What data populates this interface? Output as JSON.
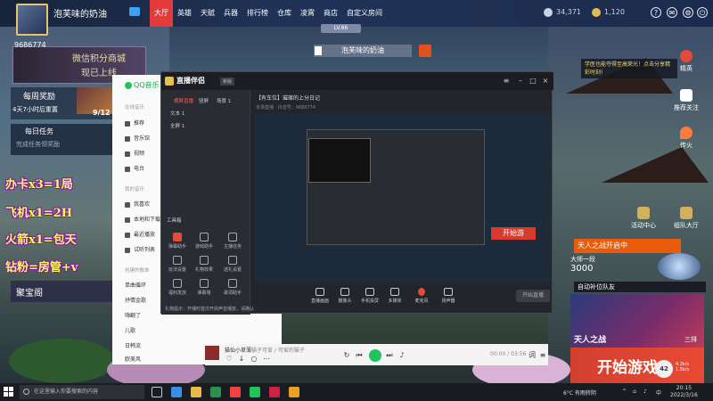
{
  "game": {
    "player_name": "泡芙味的奶油",
    "uid": "9686774",
    "level": "LV.86",
    "nav": [
      "大厅",
      "英雄",
      "天赋",
      "兵器",
      "排行榜",
      "仓库",
      "凌霄",
      "商店",
      "自定义房间"
    ],
    "currency1": "34,371",
    "currency2": "1,120",
    "shop_line1": "微信积分商城",
    "shop_line2": "现已上线",
    "reward_title": "每周奖励",
    "reward_sub": "4天7小时后重置",
    "reward_count": "9/12",
    "daily_title": "每日任务",
    "daily_sub": "完成任务领奖励",
    "treasure": "聚宝阁",
    "center_name": "泡芙味的奶油",
    "notice": "学医也能夺得至高荣光！点击分享精彩时刻!",
    "right_icons": [
      "精英",
      "推荐关注",
      "传火",
      "活动中心",
      "组队大厅"
    ],
    "tianren": "天人之战开启中",
    "rank_label": "大师一段",
    "rank_score": "3000",
    "match": "自动补位队友",
    "tianren2": "天人之战",
    "tianren2_sub": "三排",
    "start_game": "开始游戏",
    "badge": "42",
    "net_up": "4.2k/s",
    "net_down": "1.5k/s"
  },
  "overlay_lines": [
    "办卡x3=1局",
    "飞机x1=2H",
    "火箭x1=包天",
    "钻粉=房管+v"
  ],
  "qqmusic": {
    "logo": "QQ音乐",
    "sec1": "在线音乐",
    "items1": [
      "推荐",
      "音乐馆",
      "视频",
      "电台"
    ],
    "sec2": "我的音乐",
    "items2": [
      "我喜欢",
      "本地和下载",
      "最近播放",
      "试听列表"
    ],
    "sec3": "创建的歌单",
    "items3": [
      "单曲循环",
      "抒情金歌",
      "嗨翻了",
      "儿歌",
      "日韩流",
      "欧美风"
    ],
    "song": "猫仙小草薄",
    "artist": "猫子可爱 / 可爱的猫子",
    "time": "00:00 / 03:56"
  },
  "live": {
    "logo": "直播伴侣",
    "version": "新版",
    "scene_tabs": [
      "横屏直播",
      "竖屏",
      "场景 1"
    ],
    "scene_items": [
      "文本 1",
      "全屏 1"
    ],
    "tool_title": "工具箱",
    "tools": [
      "弹幕助手",
      "游戏助手",
      "主播任务",
      "玩法设置",
      "礼物效果",
      "送礼设置",
      "福利发放",
      "弹幕墙",
      "歌词助手",
      "虚拟形象",
      "更多"
    ],
    "room_title": "【有车位】璀璨的上分日记",
    "room_tag": "游戏",
    "room_sub": "本场直播 · 抖音号：9686774",
    "room_count": "2013",
    "controls": [
      "直播画面",
      "摄像头",
      "手机投屏",
      "多媒体",
      "麦克风",
      "扬声器"
    ],
    "go_live": "开始直播",
    "small_start": "开始游",
    "bottom_text": "礼物提示：开播时首次开启声音播放，请确认"
  },
  "taskbar": {
    "search": "在这里输入你要搜索的内容",
    "weather": "6°C 有雨转阴",
    "time": "20:15",
    "date": "2022/3/16",
    "lang": "中"
  }
}
